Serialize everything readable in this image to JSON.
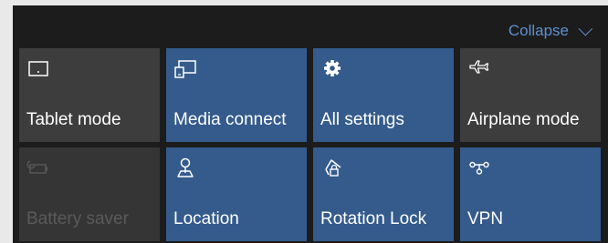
{
  "header": {
    "collapse_label": "Collapse",
    "collapse_icon": "chevron-down-icon"
  },
  "tiles": [
    {
      "label": "Tablet mode",
      "icon": "tablet-icon",
      "state": "off"
    },
    {
      "label": "Media connect",
      "icon": "media-connect-icon",
      "state": "on"
    },
    {
      "label": "All settings",
      "icon": "gear-icon",
      "state": "on"
    },
    {
      "label": "Airplane mode",
      "icon": "airplane-icon",
      "state": "off"
    },
    {
      "label": "Battery saver",
      "icon": "battery-icon",
      "state": "disabled"
    },
    {
      "label": "Location",
      "icon": "location-icon",
      "state": "on"
    },
    {
      "label": "Rotation Lock",
      "icon": "rotation-lock-icon",
      "state": "on"
    },
    {
      "label": "VPN",
      "icon": "vpn-icon",
      "state": "on"
    }
  ],
  "colors": {
    "panel_bg": "#1c1c1c",
    "tile_on": "#345b8c",
    "tile_off": "#3d3d3d",
    "tile_disabled": "#353535",
    "accent": "#5f8fcf",
    "text": "#ffffff",
    "text_disabled": "#5a5a5a"
  }
}
